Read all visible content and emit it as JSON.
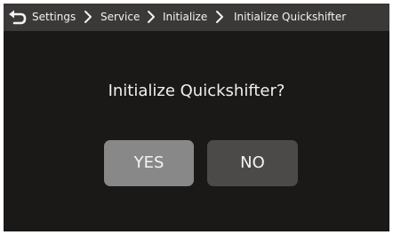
{
  "header": {
    "back_icon": "back-arrow-icon",
    "separator_icon": "chevron-right-icon",
    "breadcrumbs": [
      "Settings",
      "Service",
      "Initialize",
      "Initialize Quickshifter"
    ]
  },
  "dialog": {
    "question": "Initialize Quickshifter?",
    "yes_label": "YES",
    "no_label": "NO"
  },
  "colors": {
    "background": "#1b1818",
    "header_bar": "#3b3838",
    "yes_button": "#888888",
    "no_button": "#4c4949",
    "text": "#f0f0f0"
  }
}
